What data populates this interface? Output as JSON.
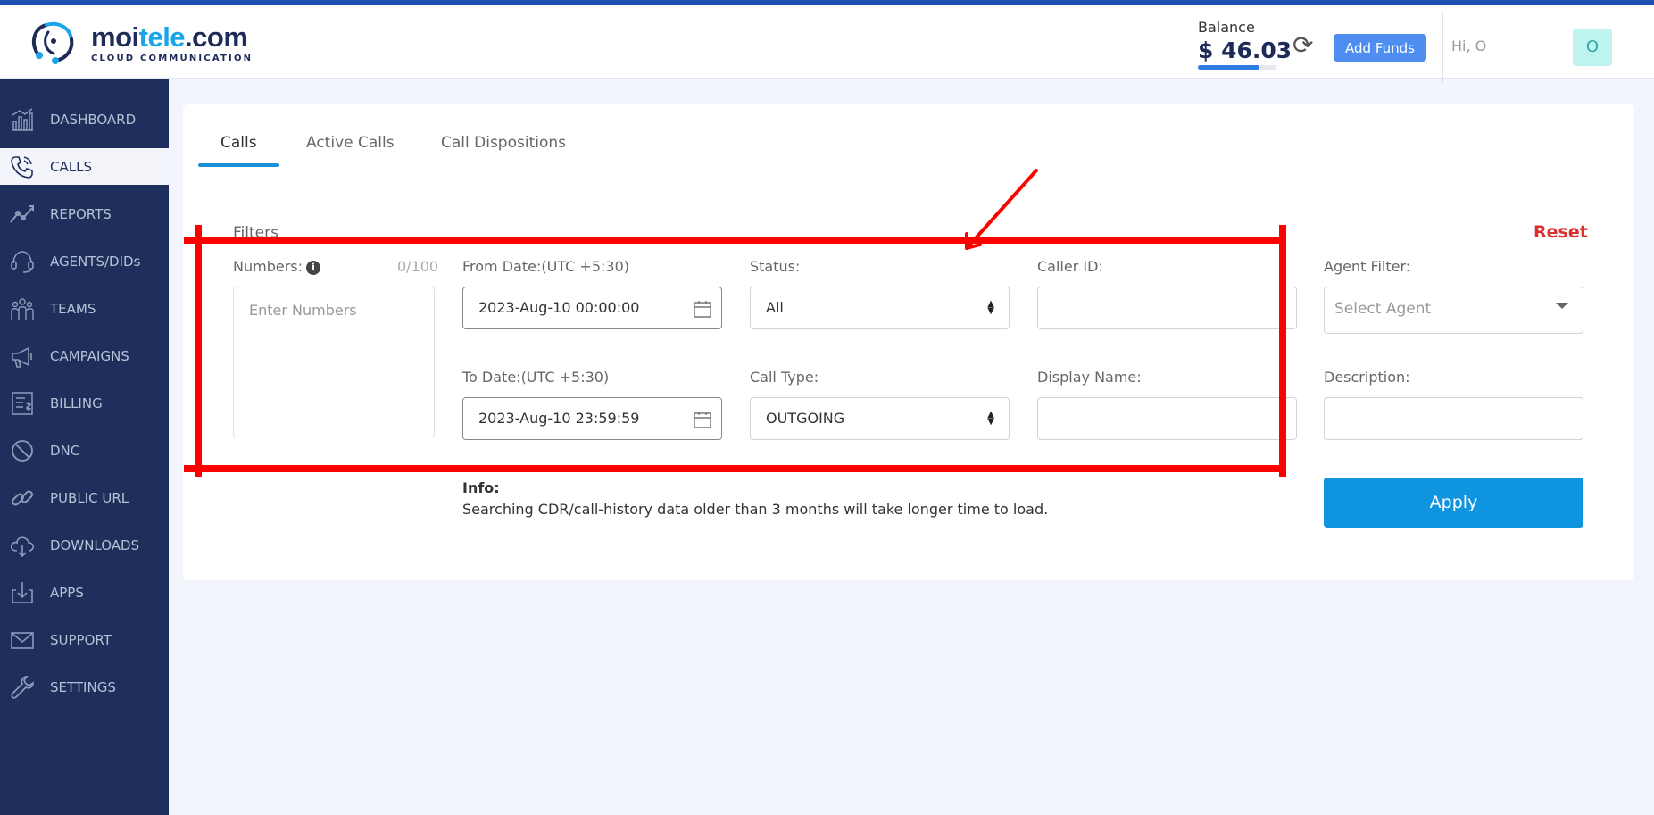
{
  "header": {
    "logo_main_prefix": "moi",
    "logo_main_accent": "tele",
    "logo_main_suffix": ".com",
    "logo_sub": "CLOUD COMMUNICATION",
    "balance_label": "Balance",
    "balance_value": "$ 46.03",
    "balance_bar_percent": 78,
    "add_funds_label": "Add Funds",
    "greeting": "Hi, O",
    "avatar_initial": "O"
  },
  "sidebar": {
    "items": [
      {
        "label": "DASHBOARD",
        "icon": "dashboard-icon"
      },
      {
        "label": "CALLS",
        "icon": "phone-icon",
        "active": true
      },
      {
        "label": "REPORTS",
        "icon": "chart-icon"
      },
      {
        "label": "AGENTS/DIDs",
        "icon": "headset-icon"
      },
      {
        "label": "TEAMS",
        "icon": "team-icon"
      },
      {
        "label": "CAMPAIGNS",
        "icon": "megaphone-icon"
      },
      {
        "label": "BILLING",
        "icon": "invoice-icon"
      },
      {
        "label": "DNC",
        "icon": "block-icon"
      },
      {
        "label": "PUBLIC URL",
        "icon": "link-icon"
      },
      {
        "label": "DOWNLOADS",
        "icon": "cloud-download-icon"
      },
      {
        "label": "APPS",
        "icon": "download-tray-icon"
      },
      {
        "label": "SUPPORT",
        "icon": "mail-icon"
      },
      {
        "label": "SETTINGS",
        "icon": "wrench-icon"
      }
    ]
  },
  "tabs": [
    {
      "label": "Calls",
      "active": true
    },
    {
      "label": "Active Calls"
    },
    {
      "label": "Call Dispositions"
    }
  ],
  "filters": {
    "title": "Filters",
    "reset_label": "Reset",
    "numbers_label": "Numbers:",
    "numbers_count": "0/100",
    "numbers_placeholder": "Enter Numbers",
    "from_date_label": "From Date:(UTC +5:30)",
    "from_date_value": "2023-Aug-10   00:00:00",
    "to_date_label": "To Date:(UTC +5:30)",
    "to_date_value": "2023-Aug-10   23:59:59",
    "status_label": "Status:",
    "status_value": "All",
    "call_type_label": "Call Type:",
    "call_type_value": "OUTGOING",
    "caller_id_label": "Caller ID:",
    "display_name_label": "Display Name:",
    "agent_filter_label": "Agent Filter:",
    "agent_placeholder": "Select Agent",
    "description_label": "Description:"
  },
  "info": {
    "title": "Info:",
    "text": "Searching CDR/call-history data older than 3 months will take longer time to load."
  },
  "apply_label": "Apply",
  "colors": {
    "sidebar_bg": "#1e2f5b",
    "accent_blue": "#0f94e0",
    "reset_red": "#d9302d",
    "annotation_red": "#ff0000"
  }
}
